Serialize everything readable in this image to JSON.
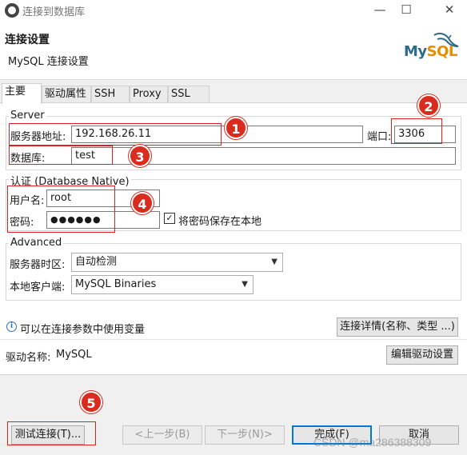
{
  "window": {
    "title": "连接到数据库",
    "minimize": "—",
    "maximize": "☐",
    "close": "✕"
  },
  "header": {
    "title": "连接设置",
    "subtitle": "MySQL 连接设置",
    "logo_text": "MySQL"
  },
  "tabs": [
    "主要",
    "驱动属性",
    "SSH",
    "Proxy",
    "SSL"
  ],
  "server": {
    "legend": "Server",
    "host_label": "服务器地址:",
    "host_value": "192.168.26.11",
    "port_label": "端口:",
    "port_value": "3306",
    "db_label": "数据库:",
    "db_value": "test"
  },
  "auth": {
    "legend": "认证 (Database Native)",
    "user_label": "用户名:",
    "user_value": "root",
    "password_label": "密码:",
    "password_value": "●●●●●●",
    "save_password_label": "将密码保存在本地",
    "save_password_checked": true
  },
  "advanced": {
    "legend": "Advanced",
    "timezone_label": "服务器时区:",
    "timezone_value": "自动检测",
    "client_label": "本地客户端:",
    "client_value": "MySQL Binaries"
  },
  "info": {
    "vars_text": "可以在连接参数中使用变量",
    "details_button": "连接详情(名称、类型 ...)"
  },
  "driver": {
    "label": "驱动名称:",
    "value": "MySQL",
    "edit_button": "编辑驱动设置"
  },
  "footer": {
    "test_button": "测试连接(T)...",
    "back_button": "<上一步(B)",
    "next_button": "下一步(N)>",
    "finish_button": "完成(F)",
    "cancel_button": "取消"
  },
  "markers": [
    "1",
    "2",
    "3",
    "4",
    "5"
  ],
  "watermark": "CSDN @ma286388309",
  "colors": {
    "marker_red": "#d92b1e",
    "highlight_red": "#e02020",
    "primary_border": "#0078d7"
  }
}
